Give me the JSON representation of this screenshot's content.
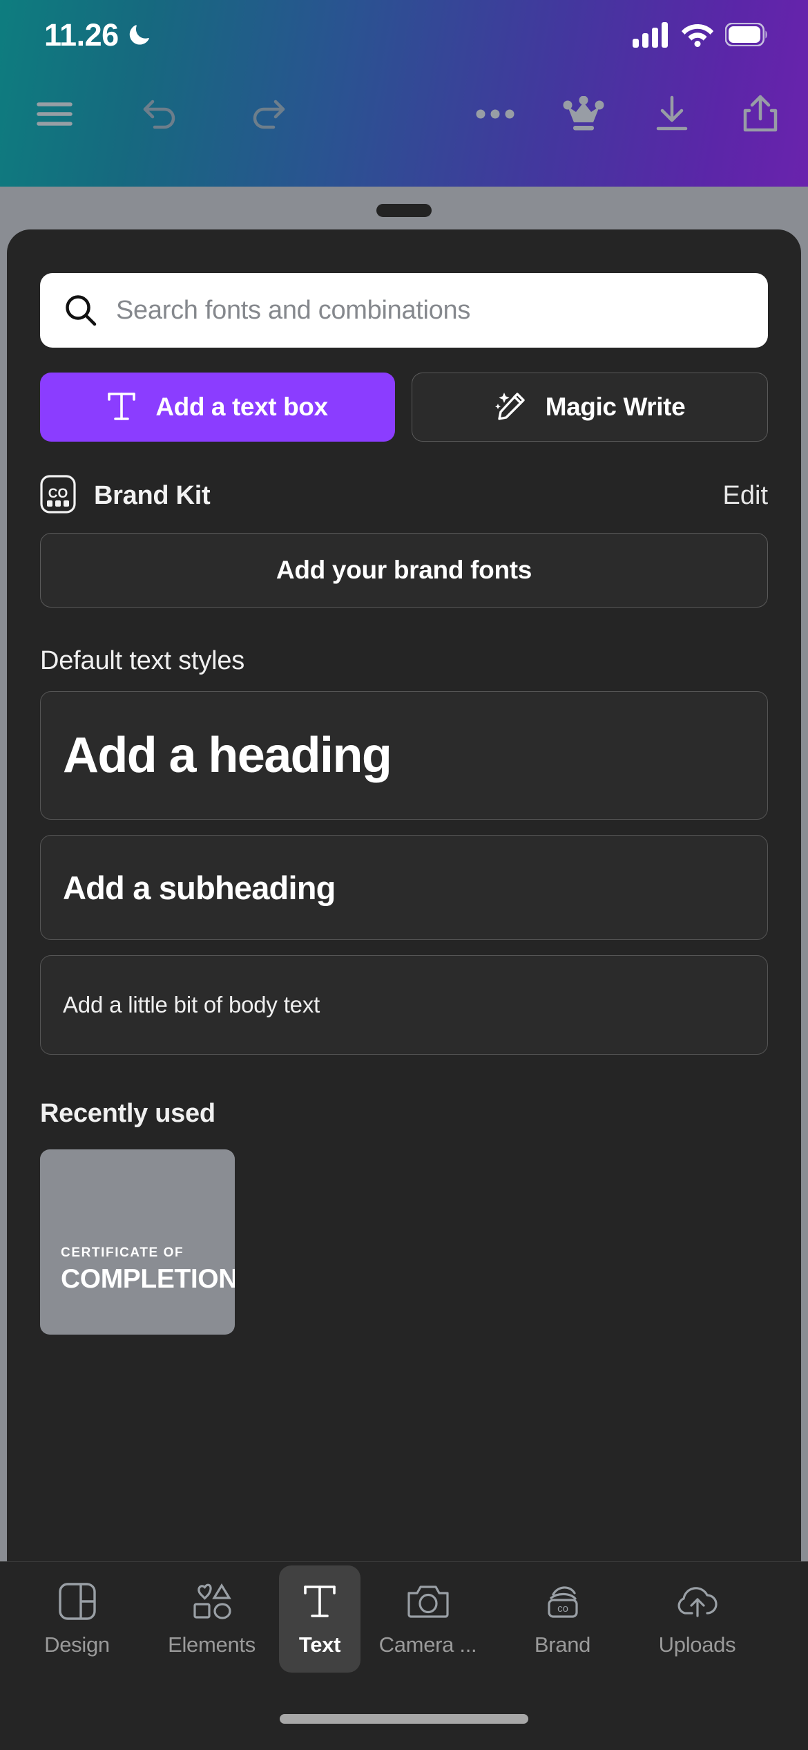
{
  "status_bar": {
    "time": "11.26",
    "dnd_icon": "moon-icon",
    "signal_icon": "cellular-signal-icon",
    "wifi_icon": "wifi-icon",
    "battery_icon": "battery-icon"
  },
  "toolbar": {
    "menu_icon": "hamburger-menu-icon",
    "undo_icon": "undo-icon",
    "redo_icon": "redo-icon",
    "more_icon": "more-options-icon",
    "crown_icon": "crown-icon",
    "download_icon": "download-icon",
    "share_icon": "share-icon"
  },
  "panel": {
    "drag_handle": "drag-handle",
    "search": {
      "icon": "search-icon",
      "placeholder": "Search fonts and combinations",
      "value": ""
    },
    "actions": {
      "add_text_box": {
        "label": "Add a text box",
        "icon": "text-t-icon",
        "color": "#8b3dff"
      },
      "magic_write": {
        "label": "Magic Write",
        "icon": "magic-wand-icon"
      }
    },
    "brand_kit": {
      "icon": "brand-kit-icon",
      "title": "Brand Kit",
      "edit_label": "Edit",
      "add_fonts_label": "Add your brand fonts"
    },
    "default_text_styles": {
      "section_label": "Default text styles",
      "items": [
        {
          "label": "Add a heading",
          "style": "heading"
        },
        {
          "label": "Add a subheading",
          "style": "subheading"
        },
        {
          "label": "Add a little bit of body text",
          "style": "body"
        }
      ]
    },
    "recently_used": {
      "section_label": "Recently used",
      "items": [
        {
          "kicker": "CERTIFICATE OF",
          "title": "COMPLETION",
          "bg": "#8a8d93"
        }
      ]
    }
  },
  "bottom_nav": {
    "items": [
      {
        "label": "Design",
        "icon": "layout-design-icon",
        "active": false
      },
      {
        "label": "Elements",
        "icon": "shapes-elements-icon",
        "active": false
      },
      {
        "label": "Text",
        "icon": "text-t-icon",
        "active": true
      },
      {
        "label": "Camera ...",
        "icon": "camera-icon",
        "active": false
      },
      {
        "label": "Brand",
        "icon": "brand-co-icon",
        "active": false
      },
      {
        "label": "Uploads",
        "icon": "cloud-upload-icon",
        "active": false
      }
    ]
  }
}
